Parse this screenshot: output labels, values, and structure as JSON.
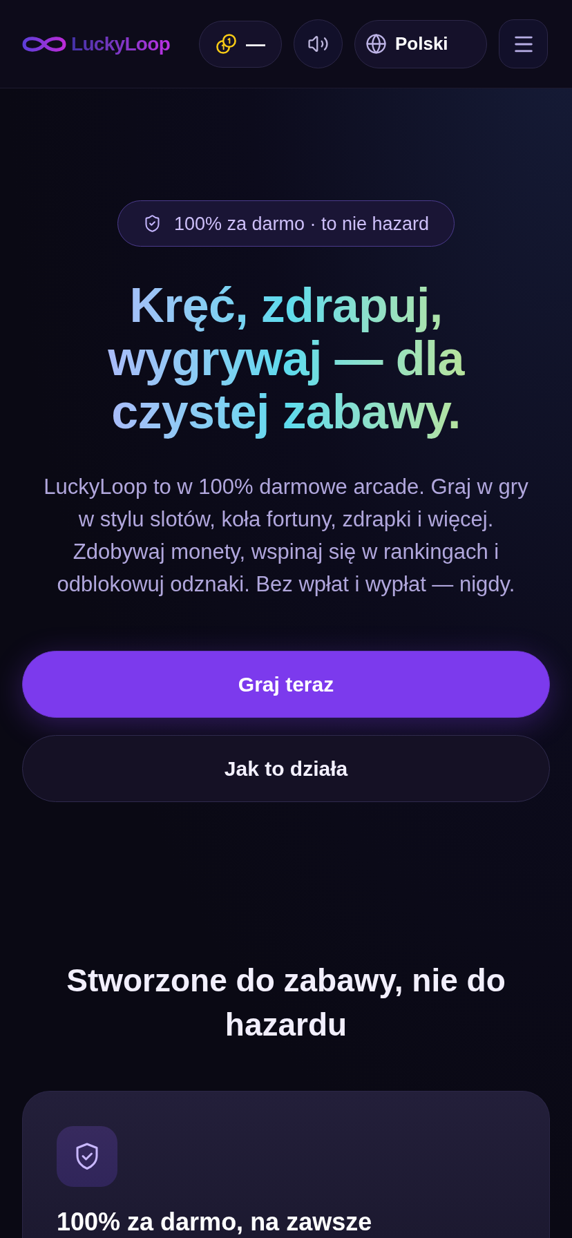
{
  "header": {
    "brand": "LuckyLoop",
    "coins": {
      "value": "—"
    },
    "sound": {
      "muted": false
    },
    "language": {
      "label": "Polski"
    }
  },
  "hero": {
    "badge": "100% za darmo · to nie hazard",
    "title": "Kręć, zdrapuj, wygrywaj — dla czystej zabawy.",
    "description": "LuckyLoop to w 100% darmowe arcade. Graj w gry w stylu slotów, koła fortuny, zdrapki i więcej. Zdobywaj monety, wspinaj się w rankingach i odblokowuj odznaki. Bez wpłat i wypłat — nigdy.",
    "buttons": [
      {
        "label": "Graj teraz",
        "kind": "primary"
      },
      {
        "label": "Jak to działa",
        "kind": "secondary"
      }
    ]
  },
  "features": {
    "heading": "Stworzone do zabawy, nie do hazardu",
    "cards": [
      {
        "title": "100% za darmo, na zawsze"
      }
    ]
  }
}
